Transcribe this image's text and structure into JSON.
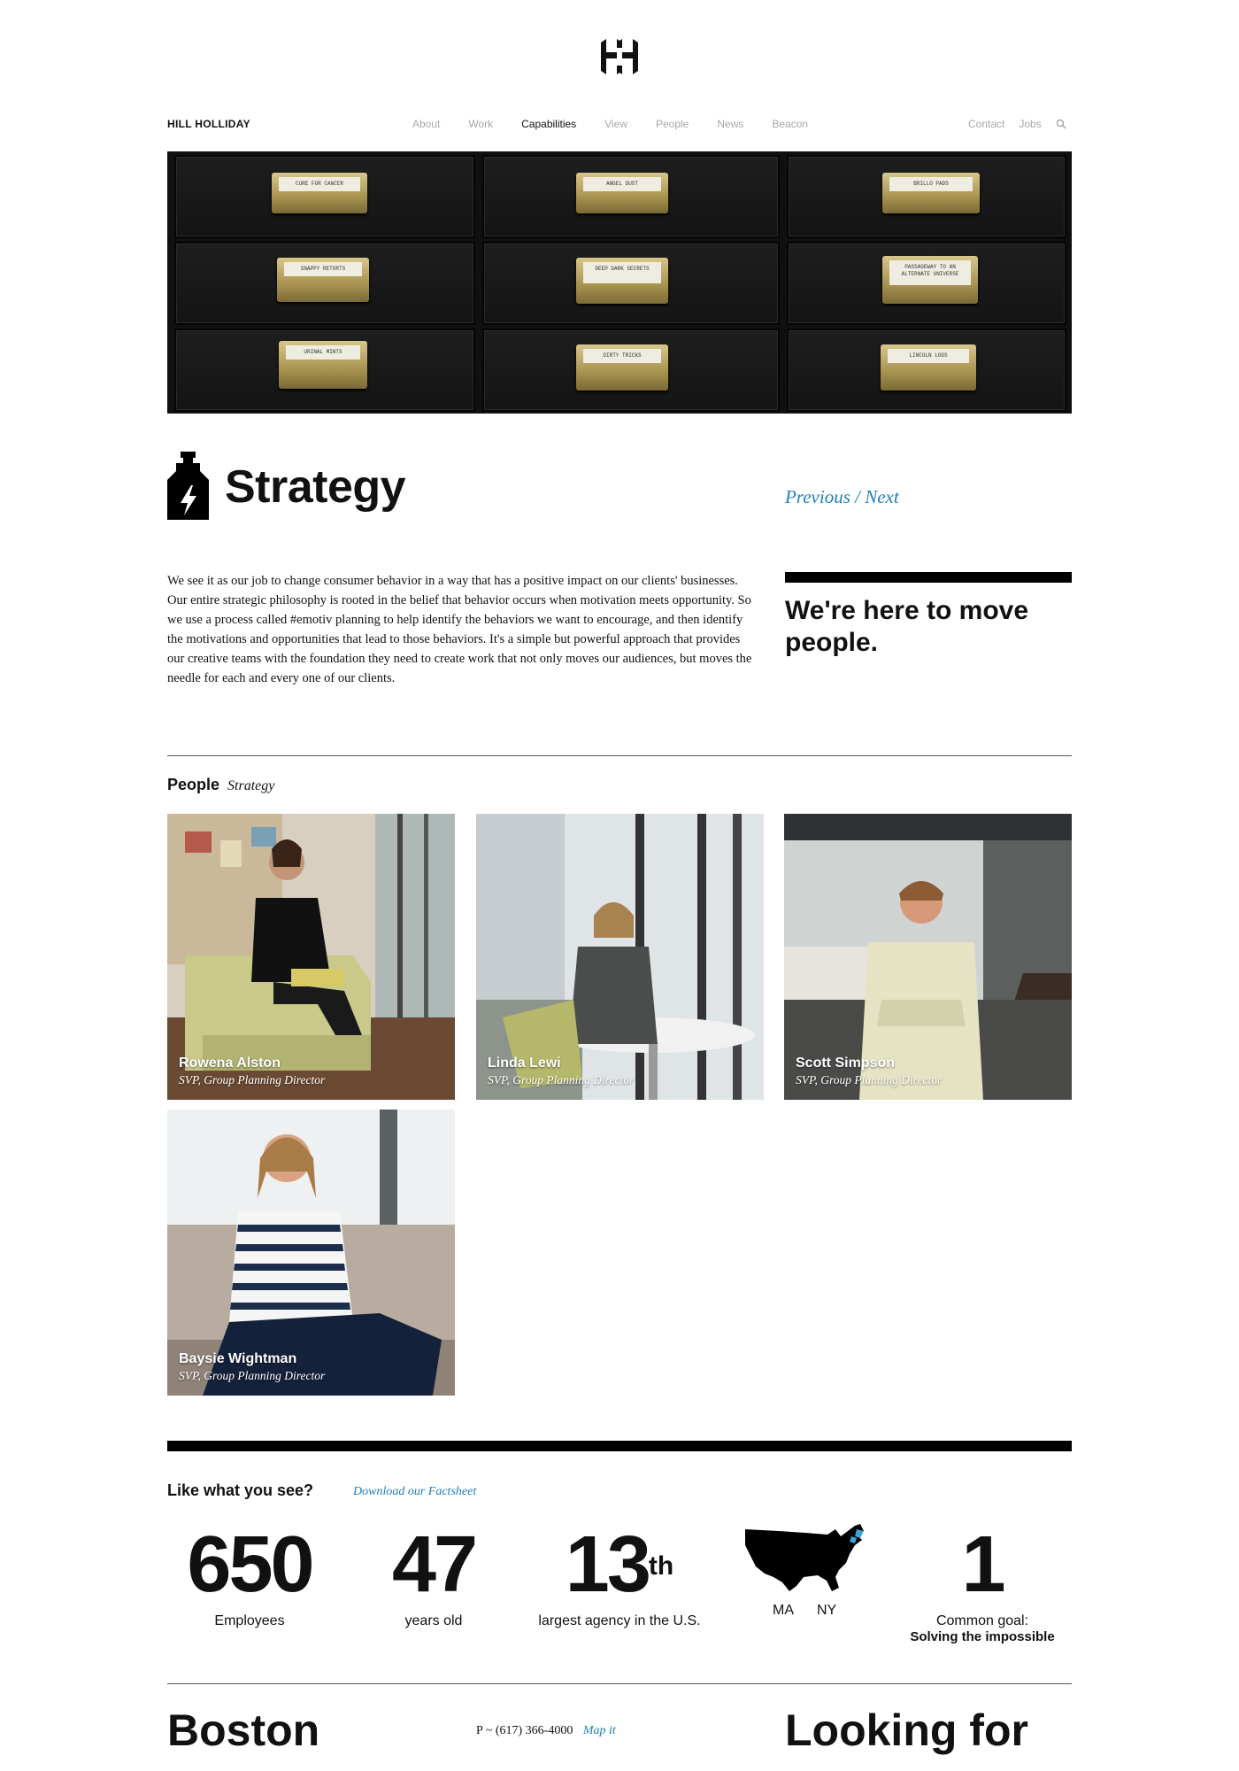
{
  "header": {
    "brand": "HILL HOLLIDAY",
    "nav": [
      {
        "label": "About"
      },
      {
        "label": "Work"
      },
      {
        "label": "Capabilities",
        "active": true
      },
      {
        "label": "View"
      },
      {
        "label": "People"
      },
      {
        "label": "News"
      },
      {
        "label": "Beacon"
      }
    ],
    "nav_right": [
      {
        "label": "Contact"
      },
      {
        "label": "Jobs"
      }
    ],
    "search_icon": "search-icon"
  },
  "hero": {
    "drawer_labels": [
      "CURE FOR CANCER",
      "ANGEL DUST",
      "BRILLO PADS",
      "SNAPPY RETORTS",
      "DEEP DARK SECRETS",
      "PASSAGEWAY TO AN ALTERNATE UNIVERSE",
      "URINAL MINTS",
      "DIRTY TRICKS",
      "LINCOLN LOGS"
    ]
  },
  "section": {
    "icon": "bottle-lightning-icon",
    "title": "Strategy",
    "previous": "Previous",
    "separator": "/",
    "next": "Next",
    "body": "We see it as our job to change consumer behavior in a way that has a positive impact on our clients' businesses. Our entire strategic philosophy is rooted in the belief that behavior occurs when motivation meets opportunity. So we use a process called #emotiv planning to help identify the behaviors we want to encourage, and then identify the motivations and opportunities that lead to those behaviors. It's a simple but powerful approach that provides our creative teams with the foundation they need to create work that not only moves our audiences, but moves the needle for each and every one of our clients.",
    "quote": "We're here to move people."
  },
  "people": {
    "heading": "People",
    "subheading": "Strategy",
    "list": [
      {
        "name": "Rowena Alston",
        "role": "SVP, Group Planning Director"
      },
      {
        "name": "Linda Lewi",
        "role": "SVP, Group Planning Director"
      },
      {
        "name": "Scott Simpson",
        "role": "SVP, Group Planning Director"
      },
      {
        "name": "Baysie Wightman",
        "role": "SVP, Group Planning Director"
      }
    ]
  },
  "facts": {
    "heading": "Like what you see?",
    "download": "Download our Factsheet",
    "stats": [
      {
        "value": "650",
        "label": "Employees"
      },
      {
        "value": "47",
        "label": "years old"
      },
      {
        "value": "13",
        "suffix": "th",
        "label": "largest agency in the U.S."
      },
      {
        "map_icon": "usa-map-icon",
        "labels": [
          "MA",
          "NY"
        ]
      },
      {
        "value": "1",
        "label": "Common goal:",
        "label2": "Solving the impossible"
      }
    ]
  },
  "footer": {
    "city": "Boston",
    "phone": "P ~ (617) 366-4000",
    "map_link": "Map it",
    "looking": "Looking for"
  },
  "colors": {
    "accent": "#1f7fb5",
    "text": "#111111",
    "nav_muted": "#a8a8a8"
  }
}
